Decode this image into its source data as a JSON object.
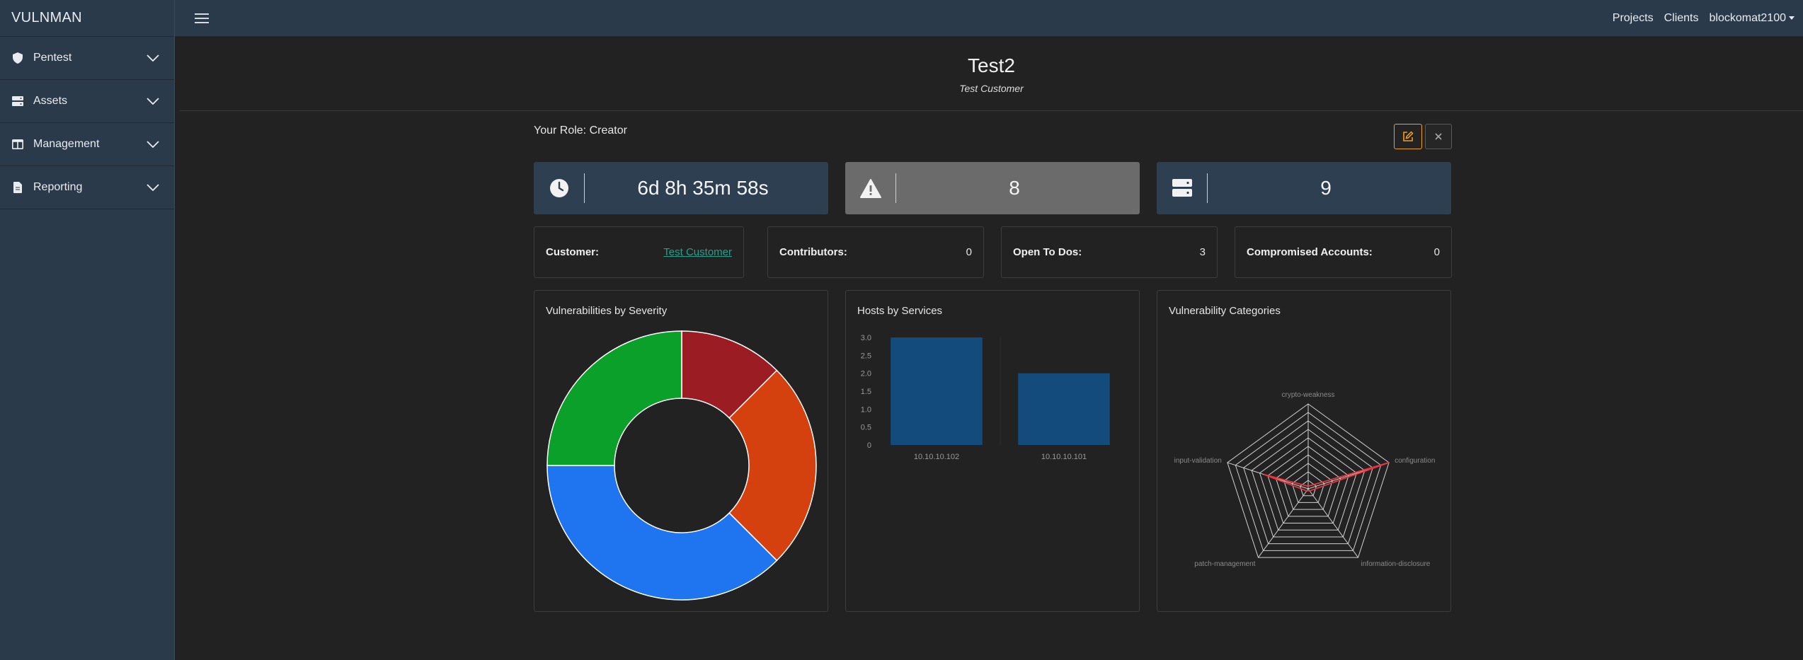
{
  "app": {
    "brand": "VULNMAN"
  },
  "sidebar": {
    "items": [
      {
        "label": "Pentest",
        "icon": "shield-icon"
      },
      {
        "label": "Assets",
        "icon": "server-icon"
      },
      {
        "label": "Management",
        "icon": "columns-icon"
      },
      {
        "label": "Reporting",
        "icon": "file-icon"
      }
    ]
  },
  "topnav": {
    "projects": "Projects",
    "clients": "Clients",
    "user": "blockomat2100"
  },
  "project": {
    "title": "Test2",
    "subtitle": "Test Customer",
    "role": "Your Role: Creator"
  },
  "stats": {
    "duration": "6d 8h 35m 58s",
    "vulnerabilities": "8",
    "hosts": "9"
  },
  "info": {
    "customer_label": "Customer:",
    "customer_value": "Test Customer",
    "contributors_label": "Contributors:",
    "contributors_value": "0",
    "todos_label": "Open To Dos:",
    "todos_value": "3",
    "accounts_label": "Compromised Accounts:",
    "accounts_value": "0"
  },
  "colors": {
    "sidebar": "#2b3a4b",
    "accent_edit": "#f0a020",
    "link": "#23a08c",
    "stat_card": "#2f3f52",
    "stat_card_alt": "#6b6b6b"
  },
  "chart_data": [
    {
      "type": "pie",
      "title": "Vulnerabilities by Severity",
      "donut": true,
      "slices": [
        {
          "value": 1,
          "color": "#9b1c23"
        },
        {
          "value": 2,
          "color": "#d5400f"
        },
        {
          "value": 3,
          "color": "#1f75f0"
        },
        {
          "value": 2,
          "color": "#0aa02a"
        }
      ]
    },
    {
      "type": "bar",
      "title": "Hosts by Services",
      "categories": [
        "10.10.10.102",
        "10.10.10.101"
      ],
      "values": [
        3,
        2
      ],
      "ylim": [
        0,
        3
      ],
      "yticks": [
        "0",
        "0.5",
        "1.0",
        "1.5",
        "2.0",
        "2.5",
        "3.0"
      ],
      "color": "#134b7c"
    },
    {
      "type": "radar",
      "title": "Vulnerability Categories",
      "axes": [
        "crypto-weakness",
        "configuration",
        "information-disclosure",
        "patch-management",
        "input-validation"
      ],
      "values": [
        0,
        1,
        0,
        0,
        0.55
      ],
      "rings": 10,
      "line_color": "#e8363f"
    }
  ]
}
